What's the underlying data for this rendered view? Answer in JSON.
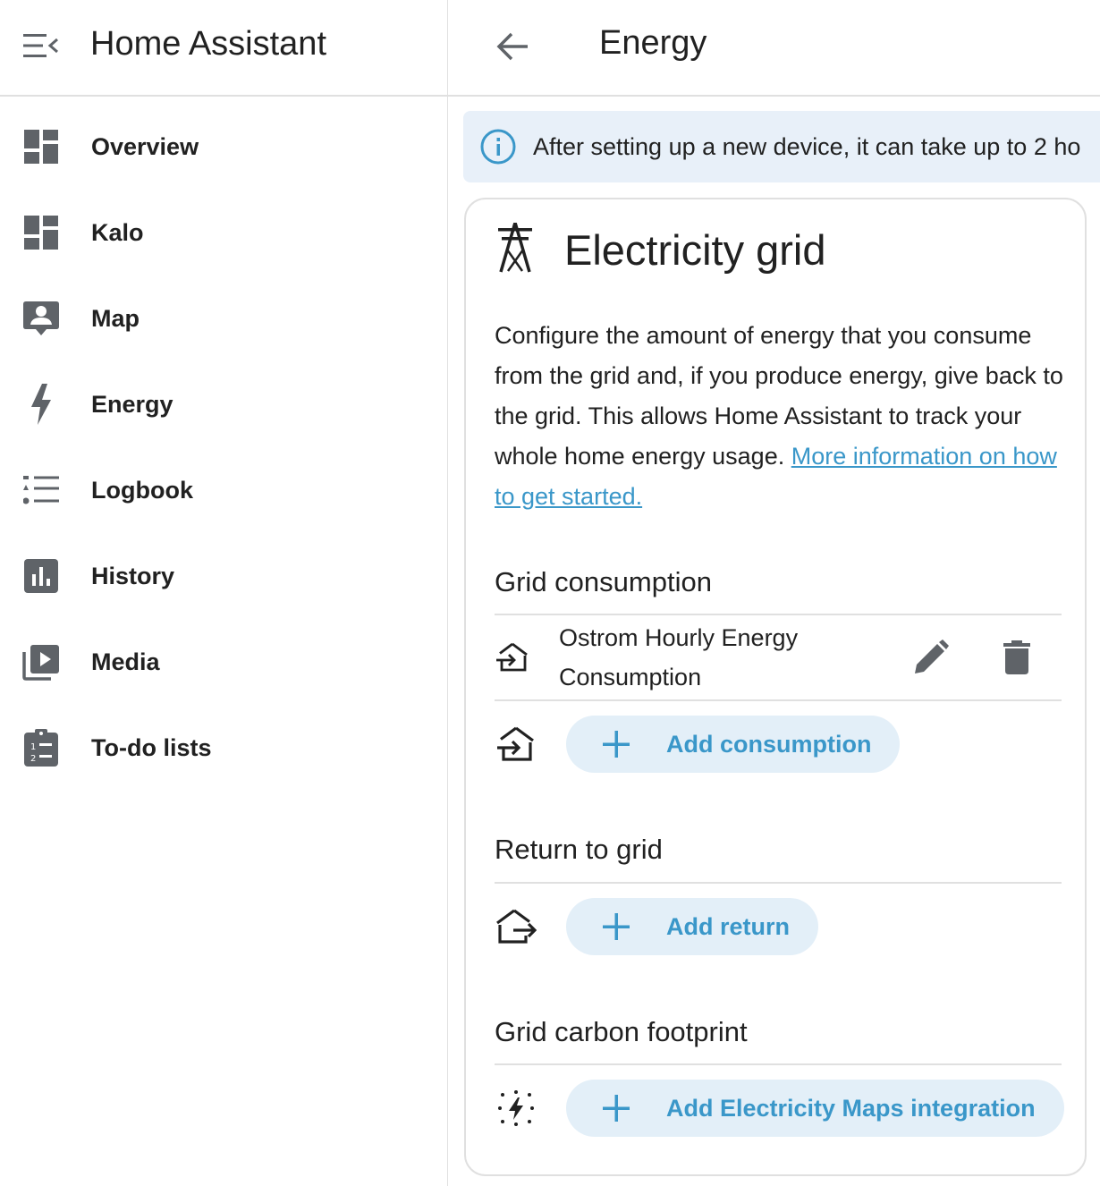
{
  "app": {
    "title": "Home Assistant"
  },
  "sidebar": {
    "items": [
      {
        "label": "Overview",
        "icon": "view-dashboard-icon"
      },
      {
        "label": "Kalo",
        "icon": "view-dashboard-icon"
      },
      {
        "label": "Map",
        "icon": "map-account-icon"
      },
      {
        "label": "Energy",
        "icon": "lightning-bolt-icon"
      },
      {
        "label": "Logbook",
        "icon": "format-list-bulleted-icon"
      },
      {
        "label": "History",
        "icon": "chart-box-icon"
      },
      {
        "label": "Media",
        "icon": "play-box-multiple-icon"
      },
      {
        "label": "To-do lists",
        "icon": "clipboard-list-icon"
      }
    ]
  },
  "header": {
    "title": "Energy"
  },
  "alert": {
    "text": "After setting up a new device, it can take up to 2 ho"
  },
  "card": {
    "title": "Electricity grid",
    "description": "Configure the amount of energy that you consume from the grid and, if you produce energy, give back to the grid. This allows Home Assistant to track your whole home energy usage. ",
    "link_text": "More information on how to get started.",
    "grid_consumption": {
      "title": "Grid consumption",
      "sources": [
        {
          "name": "Ostrom Hourly Energy Consumption"
        }
      ],
      "add_label": "Add consumption"
    },
    "return_to_grid": {
      "title": "Return to grid",
      "add_label": "Add return"
    },
    "carbon_footprint": {
      "title": "Grid carbon footprint",
      "add_label": "Add Electricity Maps integration"
    }
  },
  "colors": {
    "accent": "#3a97c9",
    "accent_bg": "#e3eff8",
    "alert_bg": "#e8f0f9",
    "icon_grey": "#5f6368"
  }
}
